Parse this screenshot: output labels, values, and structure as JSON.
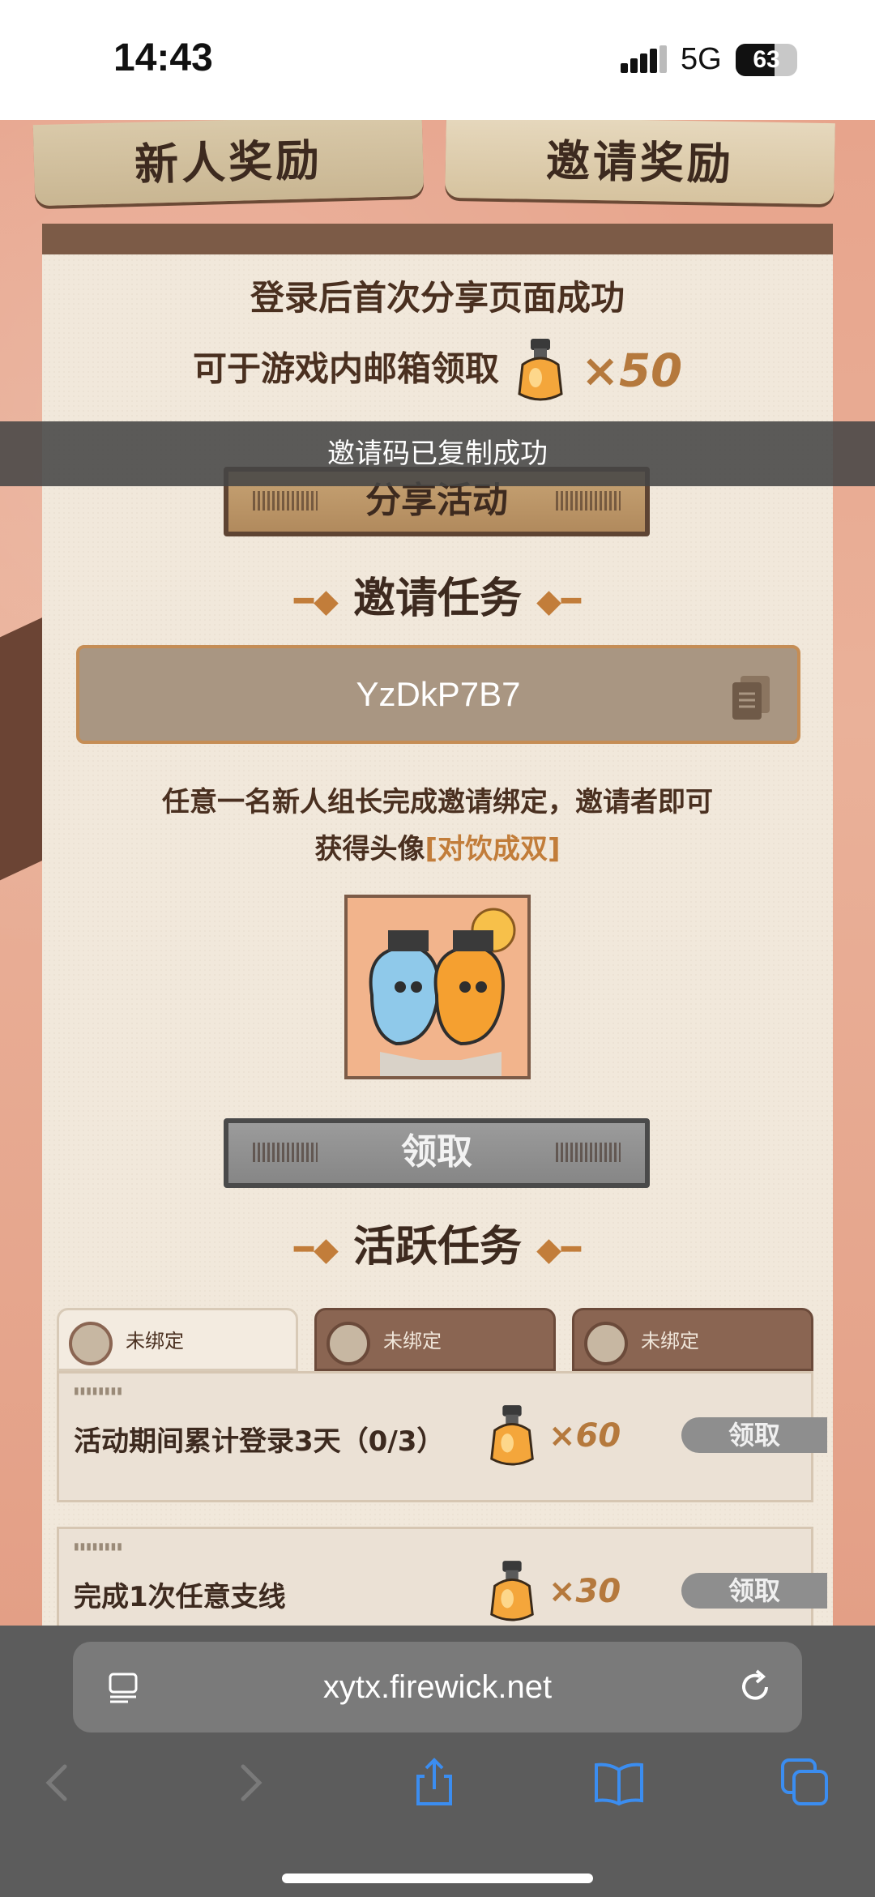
{
  "status_bar": {
    "time": "14:43",
    "network": "5G",
    "battery": "63",
    "battery_level": 0.63
  },
  "tabs": {
    "newcomer": "新人奖励",
    "invite": "邀请奖励"
  },
  "reward": {
    "line1": "登录后首次分享页面成功",
    "line2": "可于游戏内邮箱领取",
    "multiplier": "×50"
  },
  "share_button": "分享活动",
  "toast": "邀请码已复制成功",
  "invite_section": {
    "title": "邀请任务",
    "code": "YzDkP7B7",
    "desc_line1": "任意一名新人组长完成邀请绑定，邀请者即可",
    "desc_line2_prefix": "获得头像",
    "desc_line2_highlight": "[对饮成双]",
    "claim_button": "领取"
  },
  "active_section": {
    "title": "活跃任务",
    "bind_tabs": [
      "未绑定",
      "未绑定",
      "未绑定"
    ],
    "tasks": [
      {
        "name": "活动期间累计登录3天（0/3）",
        "reward": "×60",
        "button": "领取"
      },
      {
        "name": "完成1次任意支线",
        "reward": "×30",
        "button": "领取"
      }
    ]
  },
  "browser": {
    "url": "xytx.firewick.net"
  },
  "colors": {
    "accent": "#c27d3a",
    "panel": "#f1e8db",
    "dark_brown": "#3d2a1f"
  }
}
